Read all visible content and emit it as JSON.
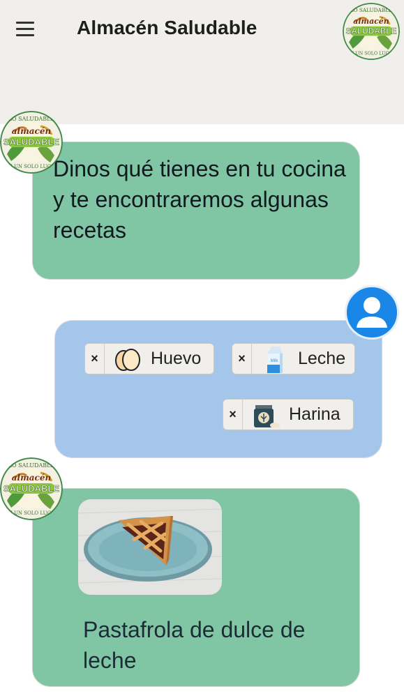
{
  "header": {
    "title": "Almacén Saludable",
    "menu_icon": "hamburger-menu-icon",
    "logo": {
      "top_text": "LO SALUDABLE",
      "main_text": "almacén",
      "big_text": "SALUDABLE",
      "bottom_text": "EN UN SOLO LUGAR"
    }
  },
  "chat": {
    "bot_message_1": "Dinos qué tienes en tu cocina y te encontraremos algunas recetas",
    "user_ingredients": [
      {
        "label": "Huevo",
        "icon": "eggs-icon",
        "remove": "×"
      },
      {
        "label": "Leche",
        "icon": "milk-carton-icon",
        "remove": "×"
      },
      {
        "label": "Harina",
        "icon": "flour-jar-icon",
        "remove": "×"
      }
    ],
    "recipe": {
      "title": "Pastafrola de dulce de leche",
      "image": "pastafrola-slice-image",
      "carton_text": "Milk"
    }
  },
  "colors": {
    "header_bg": "#f1efeb",
    "bot_bubble": "#80c6a4",
    "user_bubble": "#a4c6ea",
    "user_avatar": "#1a86e8"
  }
}
